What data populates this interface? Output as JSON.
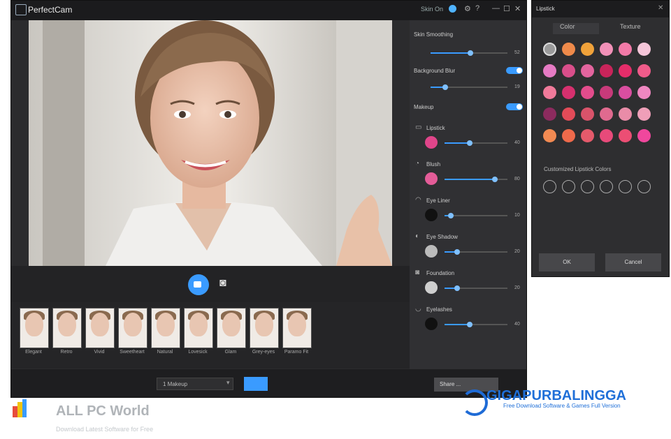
{
  "window": {
    "title": "PerfectCam",
    "skin_label": "Skin On",
    "minimize": "—",
    "maximize": "☐",
    "close": "✕"
  },
  "presets": [
    {
      "label": "Elegant"
    },
    {
      "label": "Retro"
    },
    {
      "label": "Vivid"
    },
    {
      "label": "Sweetheart"
    },
    {
      "label": "Natural"
    },
    {
      "label": "Lovesick"
    },
    {
      "label": "Glam"
    },
    {
      "label": "Grey-eyes"
    },
    {
      "label": "Paramo Fit"
    }
  ],
  "bottom": {
    "filter_value": "1 Makeup",
    "right_button": "Share ..."
  },
  "panel": {
    "skin_smoothing": {
      "label": "Skin Smoothing",
      "value": "52",
      "level": 0.52
    },
    "background_blur": {
      "label": "Background Blur",
      "value": "19",
      "level": 0.19,
      "on": true
    },
    "makeup": {
      "label": "Makeup",
      "on": true
    },
    "items": [
      {
        "label": "Lipstick",
        "value": "40",
        "level": 0.4,
        "swatch": "#e0458a"
      },
      {
        "label": "Blush",
        "value": "80",
        "level": 0.8,
        "swatch": "#e45c98"
      },
      {
        "label": "Eye Liner",
        "value": "10",
        "level": 0.1,
        "swatch": "#111111"
      },
      {
        "label": "Eye Shadow",
        "value": "20",
        "level": 0.2,
        "swatch": "#bbbbbb"
      },
      {
        "label": "Foundation",
        "value": "20",
        "level": 0.2,
        "swatch": "#cfcfcf"
      },
      {
        "label": "Eyelashes",
        "value": "40",
        "level": 0.4,
        "swatch": "#111111"
      }
    ]
  },
  "lipstick_dialog": {
    "title": "Lipstick",
    "tabs": [
      "Color",
      "Texture"
    ],
    "custom_label": "Customized Lipstick Colors",
    "ok": "OK",
    "cancel": "Cancel",
    "palette": [
      [
        "#9a9a9a",
        "#ef8a4a",
        "#f0a23a",
        "#f291b8",
        "#f27aa8",
        "#f5c6d9"
      ],
      [
        "#e67bc4",
        "#d94e8a",
        "#e3649e",
        "#c9245a",
        "#e52d6a",
        "#f05b8a"
      ],
      [
        "#f07a9a",
        "#d6306e",
        "#e34c8c",
        "#c83a7a",
        "#d94ea0",
        "#ef87c1"
      ],
      [
        "#8c2b5e",
        "#e24b58",
        "#d9536a",
        "#e06a8f",
        "#e98ca8",
        "#ef9fb8"
      ],
      [
        "#f28a52",
        "#ef6a4b",
        "#e55a6b",
        "#e84a7a",
        "#ec4e74",
        "#f0479d"
      ]
    ]
  },
  "watermarks": {
    "allpc_title": "ALL PC World",
    "allpc_sub": "Download Latest Software for Free",
    "giga_title": "GIGAPURBALINGGA",
    "giga_sub": "Free Download Software & Games Full Version"
  }
}
